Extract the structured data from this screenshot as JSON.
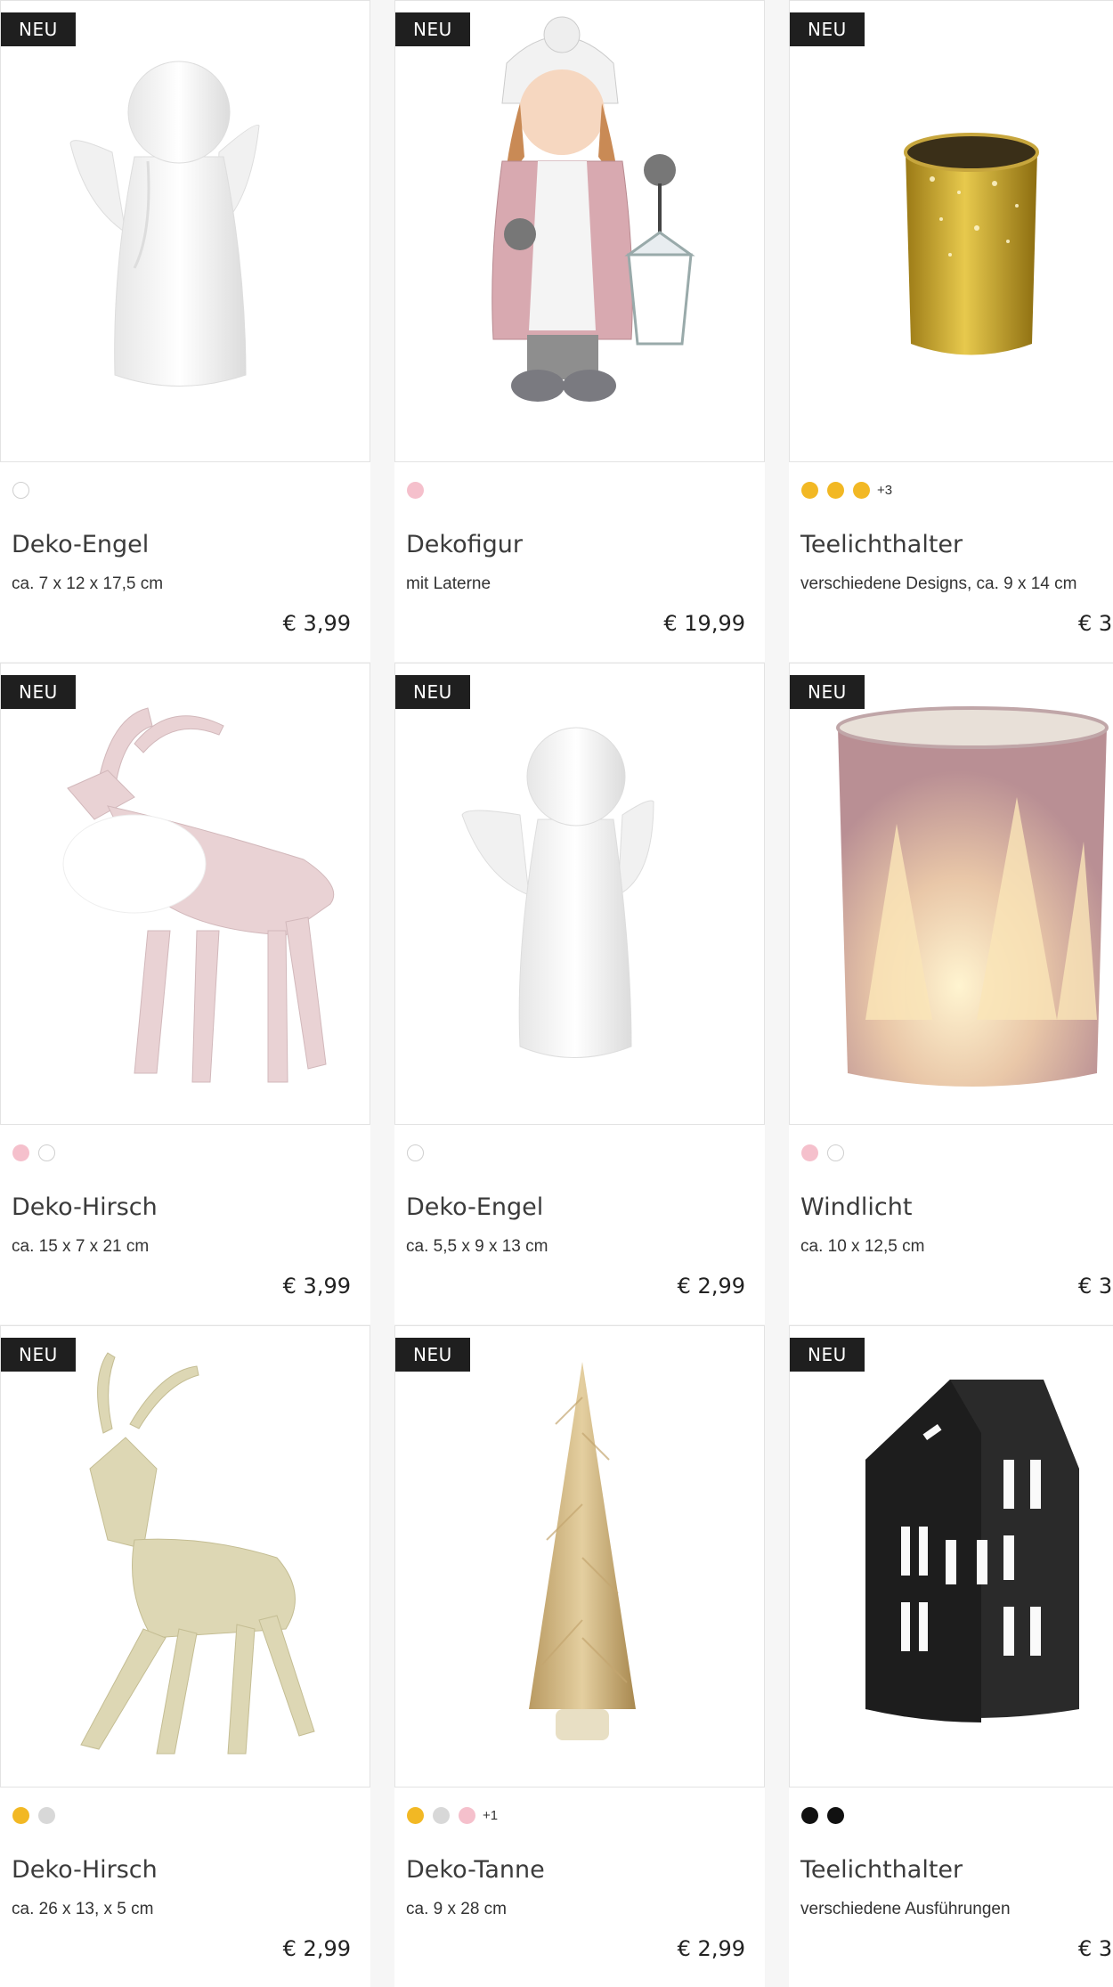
{
  "products": [
    {
      "badge": "NEU",
      "name": "Deko-Engel",
      "desc": "ca. 7 x 12 x 17,5 cm",
      "price": "€ 3,99",
      "swatches": [
        "#ffffff"
      ],
      "more": "",
      "icon": "angel-figurine"
    },
    {
      "badge": "NEU",
      "name": "Dekofigur",
      "desc": "mit Laterne",
      "price": "€ 19,99",
      "swatches": [
        "#f5c0cc"
      ],
      "more": "",
      "icon": "girl-with-lantern-figurine"
    },
    {
      "badge": "NEU",
      "name": "Teelichthalter",
      "desc": "verschiedene Designs, ca. 9 x 14 cm",
      "price": "€ 3,",
      "swatches": [
        "#f2b824",
        "#f2b824",
        "#f2b824"
      ],
      "more": "+3",
      "icon": "gold-tealight-holder"
    },
    {
      "badge": "NEU",
      "name": "Deko-Hirsch",
      "desc": "ca. 15 x 7 x 21 cm",
      "price": "€ 3,99",
      "swatches": [
        "#f5c0cc",
        "#ffffff"
      ],
      "more": "",
      "icon": "pink-deer-figurine"
    },
    {
      "badge": "NEU",
      "name": "Deko-Engel",
      "desc": "ca. 5,5 x 9 x 13 cm",
      "price": "€ 2,99",
      "swatches": [
        "#ffffff"
      ],
      "more": "",
      "icon": "angel-figurine"
    },
    {
      "badge": "NEU",
      "name": "Windlicht",
      "desc": "ca. 10 x 12,5 cm",
      "price": "€ 3,",
      "swatches": [
        "#f5c0cc",
        "#ffffff"
      ],
      "more": "",
      "icon": "forest-lantern-glass"
    },
    {
      "badge": "NEU",
      "name": "Deko-Hirsch",
      "desc": "ca. 26 x 13, x 5 cm",
      "price": "€ 2,99",
      "swatches": [
        "#f2b824",
        "#d8d8d8"
      ],
      "more": "",
      "icon": "gold-deer-figurine"
    },
    {
      "badge": "NEU",
      "name": "Deko-Tanne",
      "desc": "ca. 9 x 28 cm",
      "price": "€ 2,99",
      "swatches": [
        "#f2b824",
        "#d8d8d8",
        "#f5c0cc"
      ],
      "more": "+1",
      "icon": "bottle-brush-tree"
    },
    {
      "badge": "NEU",
      "name": "Teelichthalter",
      "desc": "verschiedene Ausführungen",
      "price": "€ 3,",
      "swatches": [
        "#111111",
        "#111111"
      ],
      "more": "",
      "icon": "black-house-tealight-holder"
    }
  ]
}
